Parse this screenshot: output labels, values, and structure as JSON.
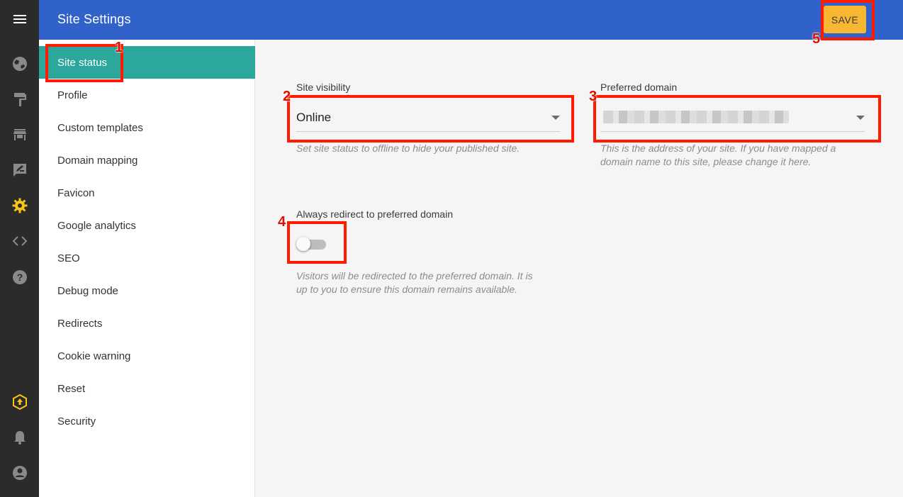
{
  "header": {
    "title": "Site Settings",
    "save_label": "SAVE"
  },
  "rail": {
    "icons": [
      "menu-icon",
      "globe-icon",
      "paint-roller-icon",
      "store-icon",
      "edit-note-icon",
      "gear-icon",
      "code-icon",
      "help-icon",
      "upgrade-icon",
      "bell-icon",
      "account-icon"
    ],
    "active": "gear-icon"
  },
  "nav": {
    "items": [
      {
        "label": "Site status",
        "active": true
      },
      {
        "label": "Profile"
      },
      {
        "label": "Custom templates"
      },
      {
        "label": "Domain mapping"
      },
      {
        "label": "Favicon"
      },
      {
        "label": "Google analytics"
      },
      {
        "label": "SEO"
      },
      {
        "label": "Debug mode"
      },
      {
        "label": "Redirects"
      },
      {
        "label": "Cookie warning"
      },
      {
        "label": "Reset"
      },
      {
        "label": "Security"
      }
    ]
  },
  "main": {
    "visibility": {
      "label": "Site visibility",
      "value": "Online",
      "help": "Set site status to offline to hide your published site."
    },
    "domain": {
      "label": "Preferred domain",
      "help_line1": "This is the address of your site. If you have mapped a",
      "help_line2": "domain name to this site, please change it here."
    },
    "redirect": {
      "label": "Always redirect to preferred domain",
      "enabled": false,
      "help_line1": "Visitors will be redirected to the preferred domain. It is",
      "help_line2": "up to you to ensure this domain remains available."
    }
  },
  "annotations": {
    "a1": "1",
    "a2": "2",
    "a3": "3",
    "a4": "4",
    "a5": "5",
    "color": "#ff1a00"
  },
  "colors": {
    "header": "#3162c9",
    "accent": "#2ba89b",
    "save": "#f7b733",
    "active_icon": "#f5c518"
  }
}
